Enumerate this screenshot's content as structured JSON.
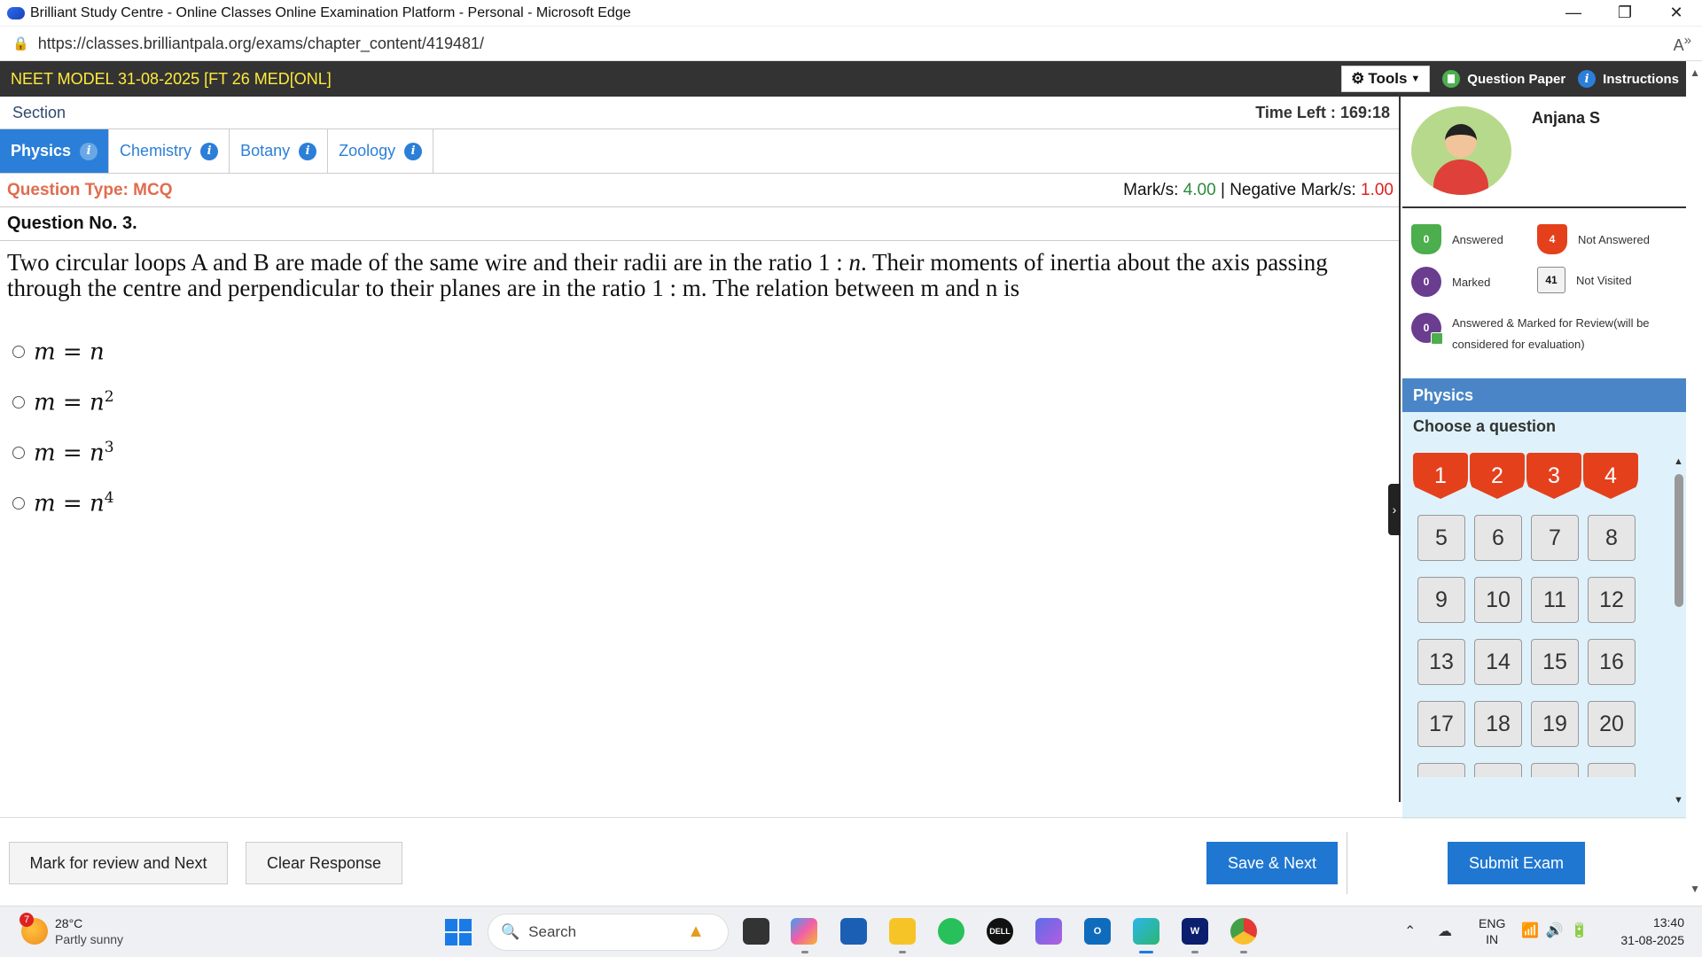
{
  "browser": {
    "window_title": "Brilliant Study Centre - Online Classes Online Examination Platform - Personal - Microsoft Edge",
    "url": "https://classes.brilliantpala.org/exams/chapter_content/419481/",
    "controls": {
      "minimize": "—",
      "restore": "❐",
      "close": "✕"
    }
  },
  "exam": {
    "title": "NEET MODEL 31-08-2025 [FT 26 MED[ONL]",
    "tools_label": "Tools",
    "question_paper_label": "Question Paper",
    "instructions_label": "Instructions",
    "section_label": "Section",
    "time_left_label": "Time Left :",
    "time_left_value": "169:18"
  },
  "tabs": [
    {
      "label": "Physics",
      "active": true
    },
    {
      "label": "Chemistry",
      "active": false
    },
    {
      "label": "Botany",
      "active": false
    },
    {
      "label": "Zoology",
      "active": false
    }
  ],
  "question": {
    "type_label": "Question Type: MCQ",
    "marks_label": "Mark/s:",
    "marks_value": "4.00",
    "separator": "|",
    "negative_label": "Negative Mark/s:",
    "negative_value": "1.00",
    "number_label": "Question No. 3.",
    "text_part1": "Two circular loops A and B are made of the same wire and their radii are in the ratio 1 : ",
    "text_var": "n",
    "text_part2": ". Their moments of inertia about the axis passing through the centre and perpendicular to their planes are in the ratio 1 : m. The relation between m and n is",
    "options": [
      {
        "lhs": "m = n",
        "exp": ""
      },
      {
        "lhs": "m = n",
        "exp": "2"
      },
      {
        "lhs": "m = n",
        "exp": "3"
      },
      {
        "lhs": "m = n",
        "exp": "4"
      }
    ]
  },
  "candidate": {
    "name": "Anjana S"
  },
  "legend": {
    "answered": {
      "count": "0",
      "label": "Answered"
    },
    "not_answered": {
      "count": "4",
      "label": "Not Answered"
    },
    "marked": {
      "count": "0",
      "label": "Marked"
    },
    "not_visited": {
      "count": "41",
      "label": "Not Visited"
    },
    "answered_marked": {
      "count": "0",
      "label": "Answered & Marked for Review(will be considered for evaluation)"
    }
  },
  "palette": {
    "section": "Physics",
    "choose_label": "Choose a question",
    "questions": [
      {
        "n": "1",
        "status": "not-answered"
      },
      {
        "n": "2",
        "status": "not-answered"
      },
      {
        "n": "3",
        "status": "not-answered"
      },
      {
        "n": "4",
        "status": "not-answered"
      },
      {
        "n": "5",
        "status": "not-visited"
      },
      {
        "n": "6",
        "status": "not-visited"
      },
      {
        "n": "7",
        "status": "not-visited"
      },
      {
        "n": "8",
        "status": "not-visited"
      },
      {
        "n": "9",
        "status": "not-visited"
      },
      {
        "n": "10",
        "status": "not-visited"
      },
      {
        "n": "11",
        "status": "not-visited"
      },
      {
        "n": "12",
        "status": "not-visited"
      },
      {
        "n": "13",
        "status": "not-visited"
      },
      {
        "n": "14",
        "status": "not-visited"
      },
      {
        "n": "15",
        "status": "not-visited"
      },
      {
        "n": "16",
        "status": "not-visited"
      },
      {
        "n": "17",
        "status": "not-visited"
      },
      {
        "n": "18",
        "status": "not-visited"
      },
      {
        "n": "19",
        "status": "not-visited"
      },
      {
        "n": "20",
        "status": "not-visited"
      }
    ]
  },
  "actions": {
    "mark_review": "Mark for review and Next",
    "clear": "Clear Response",
    "save_next": "Save & Next",
    "submit": "Submit Exam"
  },
  "taskbar": {
    "weather_badge": "7",
    "temperature": "28°C",
    "condition": "Partly sunny",
    "search_placeholder": "Search",
    "lang_line1": "ENG",
    "lang_line2": "IN",
    "time": "13:40",
    "date": "31-08-2025"
  },
  "colors": {
    "accent_blue": "#1f77d2",
    "not_answered_red": "#e5401c",
    "answered_green": "#4cae4c",
    "marked_purple": "#6a3d8f",
    "title_yellow": "#ffea3b"
  }
}
